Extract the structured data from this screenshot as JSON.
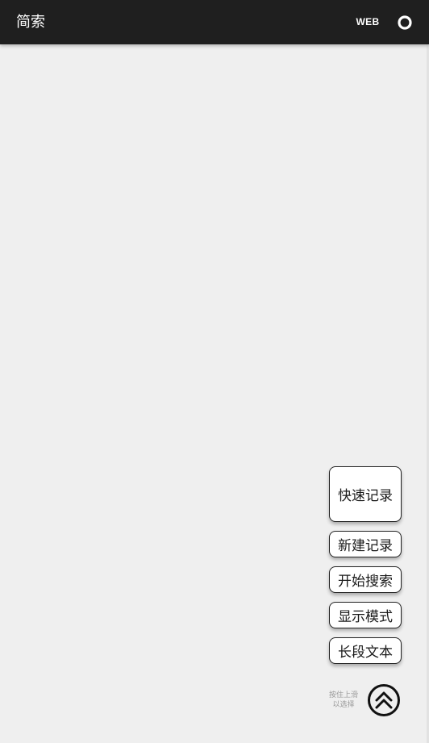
{
  "app_bar": {
    "title": "简索",
    "web_label": "WEB",
    "circle_icon": "circle-outline-icon"
  },
  "actions": {
    "quick_record": "快速记录",
    "new_record": "新建记录",
    "start_search": "开始搜索",
    "display_mode": "显示模式",
    "long_text": "长段文本"
  },
  "hint": {
    "line1": "按住上滑",
    "line2": "以选择"
  },
  "fab_icon": "double-chevron-up-icon",
  "colors": {
    "app_bar_bg": "#1f1f1f",
    "background": "#efefef",
    "button_border": "#222222",
    "hint_text": "#9a9a9a"
  }
}
